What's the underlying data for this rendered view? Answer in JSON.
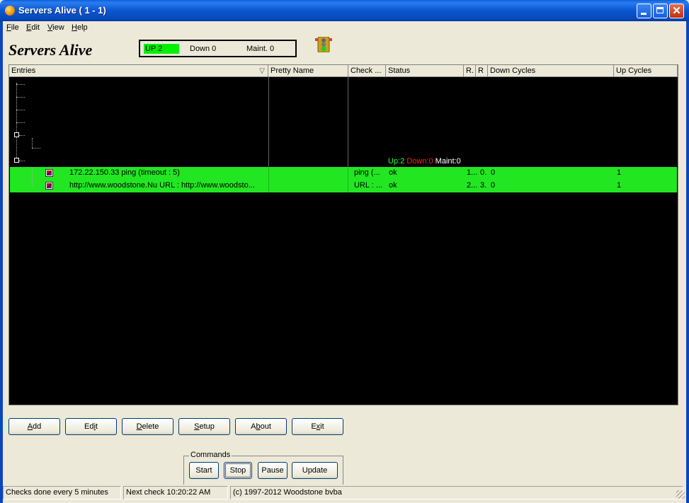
{
  "window": {
    "title": "Servers Alive ( 1 - 1)"
  },
  "menu": [
    {
      "label": "File",
      "accel": "F",
      "rest": "ile"
    },
    {
      "label": "Edit",
      "accel": "E",
      "rest": "dit"
    },
    {
      "label": "View",
      "accel": "V",
      "rest": "iew"
    },
    {
      "label": "Help",
      "accel": "H",
      "rest": "elp"
    }
  ],
  "header": {
    "app_name": "Servers Alive",
    "up": "UP  2",
    "down": "Down 0",
    "maint": "Maint. 0"
  },
  "columns": [
    "Entries",
    "Pretty Name",
    "Check ...",
    "Status",
    "R.",
    "R",
    "Down Cycles",
    "Up Cycles"
  ],
  "totals": {
    "up": "Up:2",
    "down": "Down:0",
    "maint": "Maint:0"
  },
  "rows": [
    {
      "entry": "172.22.150.33  ping   (timeout :  5)",
      "pretty": "",
      "check": "ping   (...",
      "status": "ok",
      "r1": "1...",
      "r2": "0.",
      "down_cycles": "0",
      "up_cycles": "1"
    },
    {
      "entry": "http://www.woodstone.Nu  URL : http://www.woodsto...",
      "pretty": "",
      "check": "URL : ...",
      "status": "ok",
      "r1": "2...",
      "r2": "3.",
      "down_cycles": "0",
      "up_cycles": "1"
    }
  ],
  "buttons": {
    "add": {
      "accel": "A",
      "rest": "dd"
    },
    "edit": {
      "pre": "Ed",
      "accel": "i",
      "rest": "t"
    },
    "delete": {
      "accel": "D",
      "rest": "elete"
    },
    "setup": {
      "accel": "S",
      "rest": "etup"
    },
    "about": {
      "pre": "A",
      "accel": "b",
      "rest": "out"
    },
    "exit": {
      "pre": "E",
      "accel": "x",
      "rest": "it"
    }
  },
  "commands": {
    "label": "Commands",
    "start": "Start",
    "stop": "Stop",
    "pause": "Pause",
    "update": "Update"
  },
  "status": {
    "interval": "Checks done every  5 minutes",
    "next_check": "Next check 10:20:22 AM",
    "copyright": "(c) 1997-2012 Woodstone bvba"
  },
  "colors": {
    "up": "#22e622",
    "down": "#ff2020",
    "list_bg": "#000000"
  }
}
